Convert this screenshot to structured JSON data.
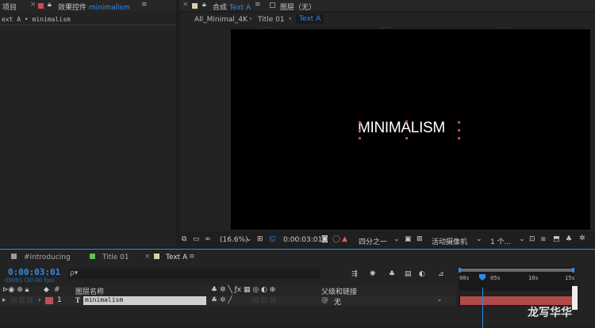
{
  "top_left": {
    "project": "项目",
    "effects_prefix": "效果控件",
    "effects_name": "minimalism",
    "menu": "≡",
    "breadcrumb": "ext A • minimalism"
  },
  "comp_panel": {
    "close": "×",
    "label": "合成",
    "comp_name": "Text A",
    "menu": "≡",
    "layer_label": "图层（无）"
  },
  "breadcrumbs": [
    "All_Minimal_4K",
    "Title 01",
    "Text A"
  ],
  "viewer": {
    "text": "MINIMALISM"
  },
  "viewer_toolbar": {
    "zoom": "(16.6%)",
    "timecode": "0:00:03:01",
    "quality": "四分之一",
    "camera": "活动摄像机",
    "views": "1 个..."
  },
  "timeline_tabs": [
    {
      "name": "#Introducing",
      "color": "#9b9b9b"
    },
    {
      "name": "Title 01",
      "color": "#59c05b"
    },
    {
      "name": "Text A",
      "color": "#d9d0a8",
      "close": "×",
      "menu": "≡"
    }
  ],
  "timeline": {
    "timecode": "0:00:03:01",
    "fps": "00091 (30.00 fps)",
    "search_placeholder": "ρ▾",
    "col_layer_name": "图层名称",
    "col_parent": "父级和链接",
    "ruler": [
      "00s",
      "05s",
      "10s",
      "15s"
    ],
    "layer": {
      "num": "1",
      "type": "T",
      "name": "minimalism",
      "parent": "无"
    }
  },
  "watermark": "龙写华华",
  "colors": {
    "accent": "#2d8ceb",
    "label_red": "#c84e4e",
    "track_bar": "#b24a4a"
  }
}
